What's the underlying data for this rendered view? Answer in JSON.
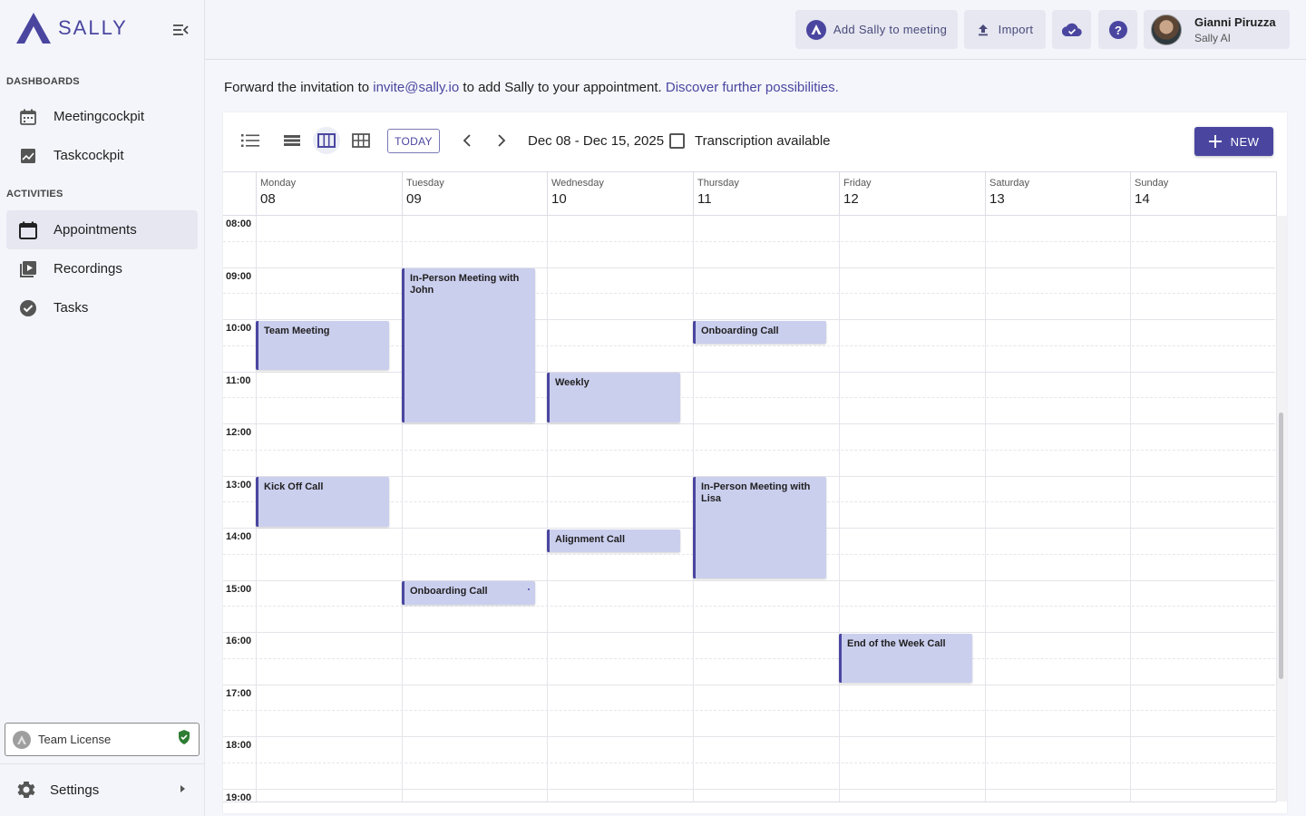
{
  "app": {
    "name": "SALLY"
  },
  "colors": {
    "accent": "#4a46a0",
    "event_fill": "#cbcfee",
    "license_ok": "#2e7d32"
  },
  "sidebar": {
    "sections": [
      {
        "label": "DASHBOARDS"
      },
      {
        "label": "ACTIVITIES"
      }
    ],
    "items": [
      {
        "label": "Meetingcockpit",
        "icon": "calendar-grid-icon"
      },
      {
        "label": "Taskcockpit",
        "icon": "chart-icon"
      },
      {
        "label": "Appointments",
        "icon": "calendar-icon",
        "active": true
      },
      {
        "label": "Recordings",
        "icon": "video-library-icon"
      },
      {
        "label": "Tasks",
        "icon": "check-circle-icon"
      }
    ],
    "license": {
      "label": "Team License"
    },
    "settings": {
      "label": "Settings"
    }
  },
  "header": {
    "add_sally_label": "Add Sally to meeting",
    "import_label": "Import",
    "user": {
      "name": "Gianni Piruzza",
      "org": "Sally AI"
    }
  },
  "intro": {
    "prefix": "Forward the invitation to ",
    "email": "invite@sally.io",
    "middle": " to add Sally to your appointment. ",
    "link": "Discover further possibilities."
  },
  "toolbar": {
    "today_label": "TODAY",
    "date_range": "Dec 08 - Dec 15, 2025",
    "transcription_label": "Transcription available",
    "transcription_checked": false,
    "new_label": "NEW"
  },
  "calendar": {
    "days": [
      {
        "name": "Monday",
        "num": "08"
      },
      {
        "name": "Tuesday",
        "num": "09"
      },
      {
        "name": "Wednesday",
        "num": "10"
      },
      {
        "name": "Thursday",
        "num": "11"
      },
      {
        "name": "Friday",
        "num": "12"
      },
      {
        "name": "Saturday",
        "num": "13"
      },
      {
        "name": "Sunday",
        "num": "14"
      }
    ],
    "hours": [
      "08:00",
      "09:00",
      "10:00",
      "11:00",
      "12:00",
      "13:00",
      "14:00",
      "15:00",
      "16:00",
      "17:00",
      "18:00",
      "19:00"
    ],
    "events": [
      {
        "title": "Team Meeting",
        "day": 0,
        "start": "10:00",
        "end": "11:00"
      },
      {
        "title": "Kick Off Call",
        "day": 0,
        "start": "13:00",
        "end": "14:00"
      },
      {
        "title": "In-Person Meeting with John",
        "day": 1,
        "start": "09:00",
        "end": "12:00"
      },
      {
        "title": "Onboarding Call",
        "day": 1,
        "start": "15:00",
        "end": "15:30"
      },
      {
        "title": "Weekly",
        "day": 2,
        "start": "11:00",
        "end": "12:00"
      },
      {
        "title": "Alignment Call",
        "day": 2,
        "start": "14:00",
        "end": "14:30"
      },
      {
        "title": "Onboarding Call",
        "day": 3,
        "start": "10:00",
        "end": "10:30"
      },
      {
        "title": "In-Person Meeting with Lisa",
        "day": 3,
        "start": "13:00",
        "end": "15:00"
      },
      {
        "title": "End of the Week Call",
        "day": 4,
        "start": "16:00",
        "end": "17:00"
      }
    ]
  }
}
